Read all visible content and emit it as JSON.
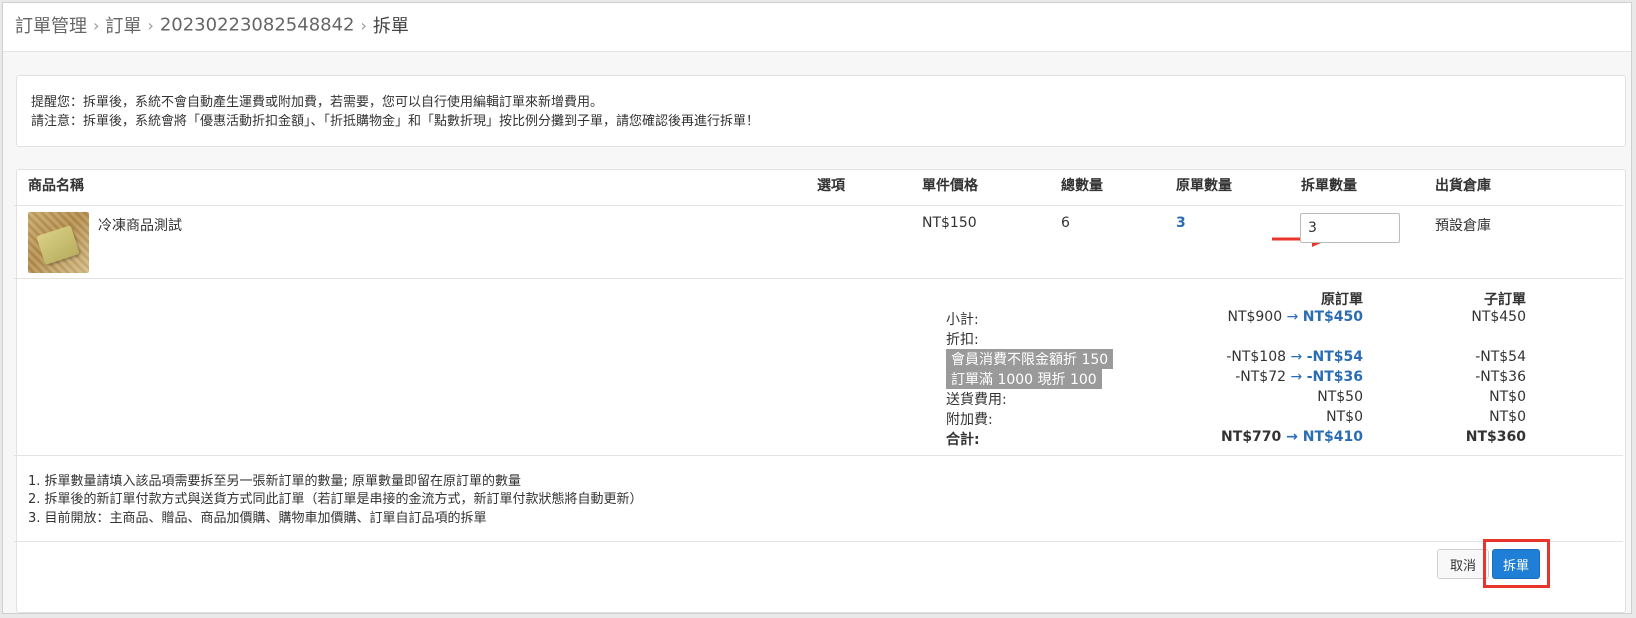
{
  "breadcrumb": {
    "items": [
      "訂單管理",
      "訂單",
      "20230223082548842",
      "拆單"
    ]
  },
  "notice": {
    "line1": "提醒您：拆單後，系統不會自動產生運費或附加費，若需要，您可以自行使用編輯訂單來新增費用。",
    "line2": "請注意：拆單後，系統會將「優惠活動折扣金額」、「折抵購物金」和「點數折現」按比例分攤到子單，請您確認後再進行拆單！"
  },
  "table": {
    "headers": {
      "name": "商品名稱",
      "option": "選項",
      "unit_price": "單件價格",
      "total_qty": "總數量",
      "orig_qty": "原單數量",
      "split_qty": "拆單數量",
      "warehouse": "出貨倉庫"
    },
    "row": {
      "name": "冷凍商品測試",
      "option": "",
      "unit_price": "NT$150",
      "total_qty": "6",
      "orig_qty": "3",
      "split_qty_value": "3",
      "warehouse": "預設倉庫"
    }
  },
  "summary": {
    "col_orig": "原訂單",
    "col_child": "子訂單",
    "subtotal_label": "小計:",
    "subtotal_orig_from": "NT$900",
    "subtotal_orig_to": "NT$450",
    "subtotal_child": "NT$450",
    "discount_label": "折扣:",
    "discount1_label": "會員消費不限金額折 150",
    "discount1_orig_from": "-NT$108",
    "discount1_orig_to": "-NT$54",
    "discount1_child": "-NT$54",
    "discount2_label": "訂單滿 1000 現折 100",
    "discount2_orig_from": "-NT$72",
    "discount2_orig_to": "-NT$36",
    "discount2_child": "-NT$36",
    "shipping_label": "送貨費用:",
    "shipping_orig": "NT$50",
    "shipping_child": "NT$0",
    "extra_label": "附加費:",
    "extra_orig": "NT$0",
    "extra_child": "NT$0",
    "total_label": "合計:",
    "total_orig_from": "NT$770",
    "total_orig_to": "NT$410",
    "total_child": "NT$360",
    "arrow": "→"
  },
  "notes": [
    "1. 拆單數量請填入該品項需要拆至另一張新訂單的數量; 原單數量即留在原訂單的數量",
    "2. 拆單後的新訂單付款方式與送貨方式同此訂單（若訂單是串接的金流方式，新訂單付款狀態將自動更新）",
    "3. 目前開放：主商品、贈品、商品加價購、購物車加價購、訂單自訂品項的拆單"
  ],
  "buttons": {
    "cancel": "取消",
    "split": "拆單"
  },
  "colors": {
    "accent_blue": "#2a6db5",
    "primary_button": "#1f7fd6",
    "annotation_red": "#e8342a"
  }
}
